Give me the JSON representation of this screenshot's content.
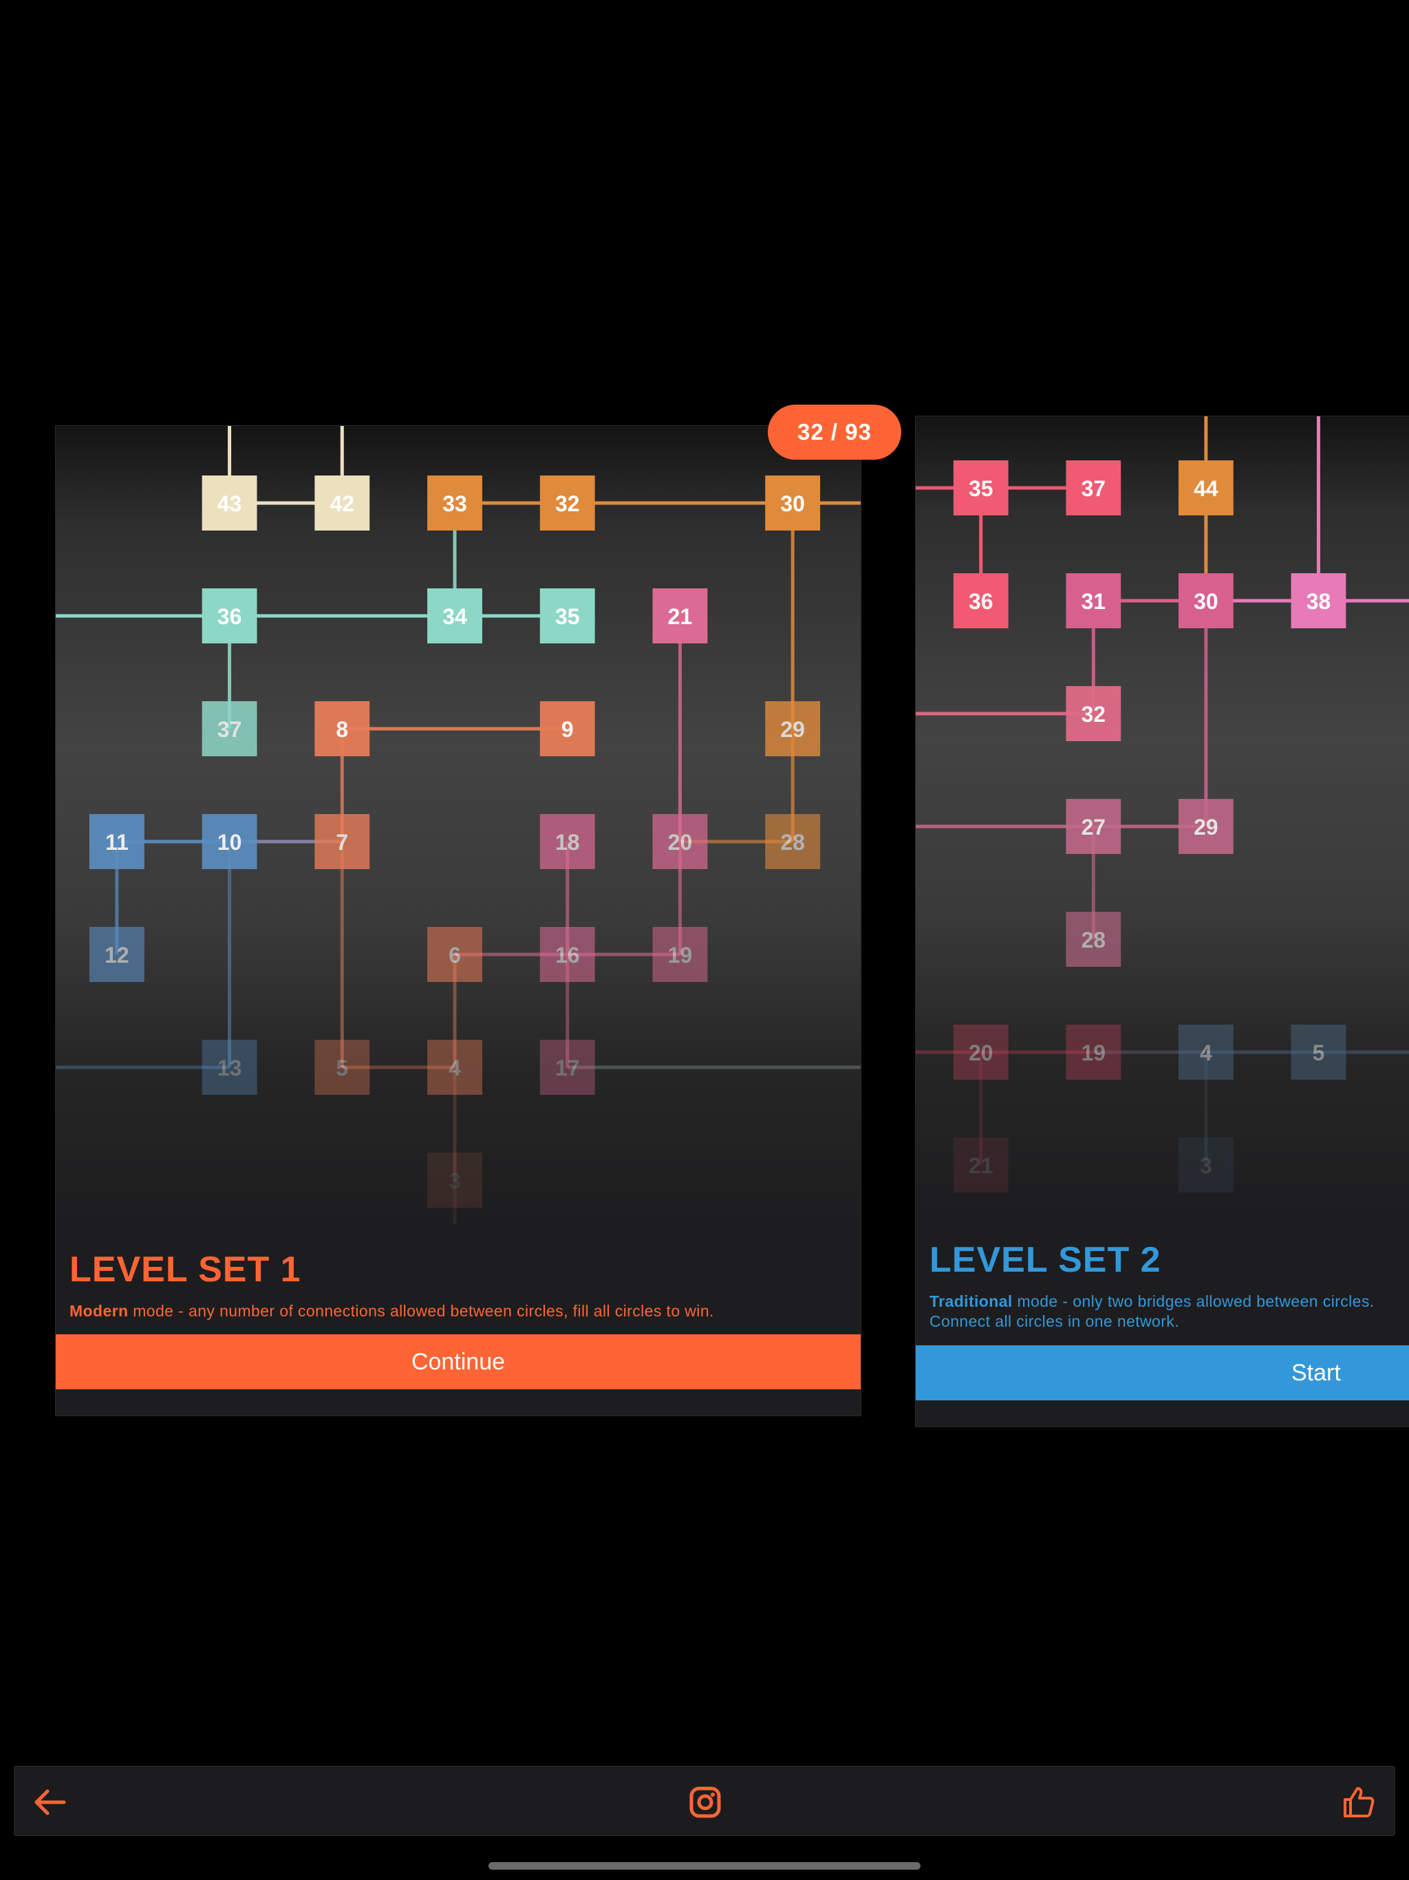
{
  "progress_badge": "32 / 93",
  "level_sets": [
    {
      "title": "LEVEL SET 1",
      "mode_name": "Modern",
      "mode_text": " mode - any number of connections allowed between circles, fill all circles to win.",
      "button_label": "Continue",
      "accent_color": "#ff6534",
      "nodes": [
        "43",
        "42",
        "33",
        "32",
        "30",
        "36",
        "34",
        "35",
        "21",
        "37",
        "8",
        "9",
        "29",
        "11",
        "10",
        "7",
        "18",
        "20",
        "28",
        "12",
        "6",
        "16",
        "19",
        "13",
        "5",
        "4",
        "17",
        "3"
      ]
    },
    {
      "title": "LEVEL SET 2",
      "mode_name": "Traditional",
      "mode_text": " mode - only two bridges allowed between circles. Connect all circles in one network.",
      "button_label": "Start",
      "accent_color": "#3398d9",
      "nodes": [
        "35",
        "37",
        "44",
        "36",
        "31",
        "30",
        "38",
        "32",
        "27",
        "29",
        "28",
        "20",
        "19",
        "4",
        "5",
        "21",
        "3"
      ]
    }
  ],
  "bottom_bar": {
    "icons": [
      "back-arrow-icon",
      "instagram-icon",
      "thumbs-up-icon"
    ],
    "icon_color": "#ff6534"
  }
}
